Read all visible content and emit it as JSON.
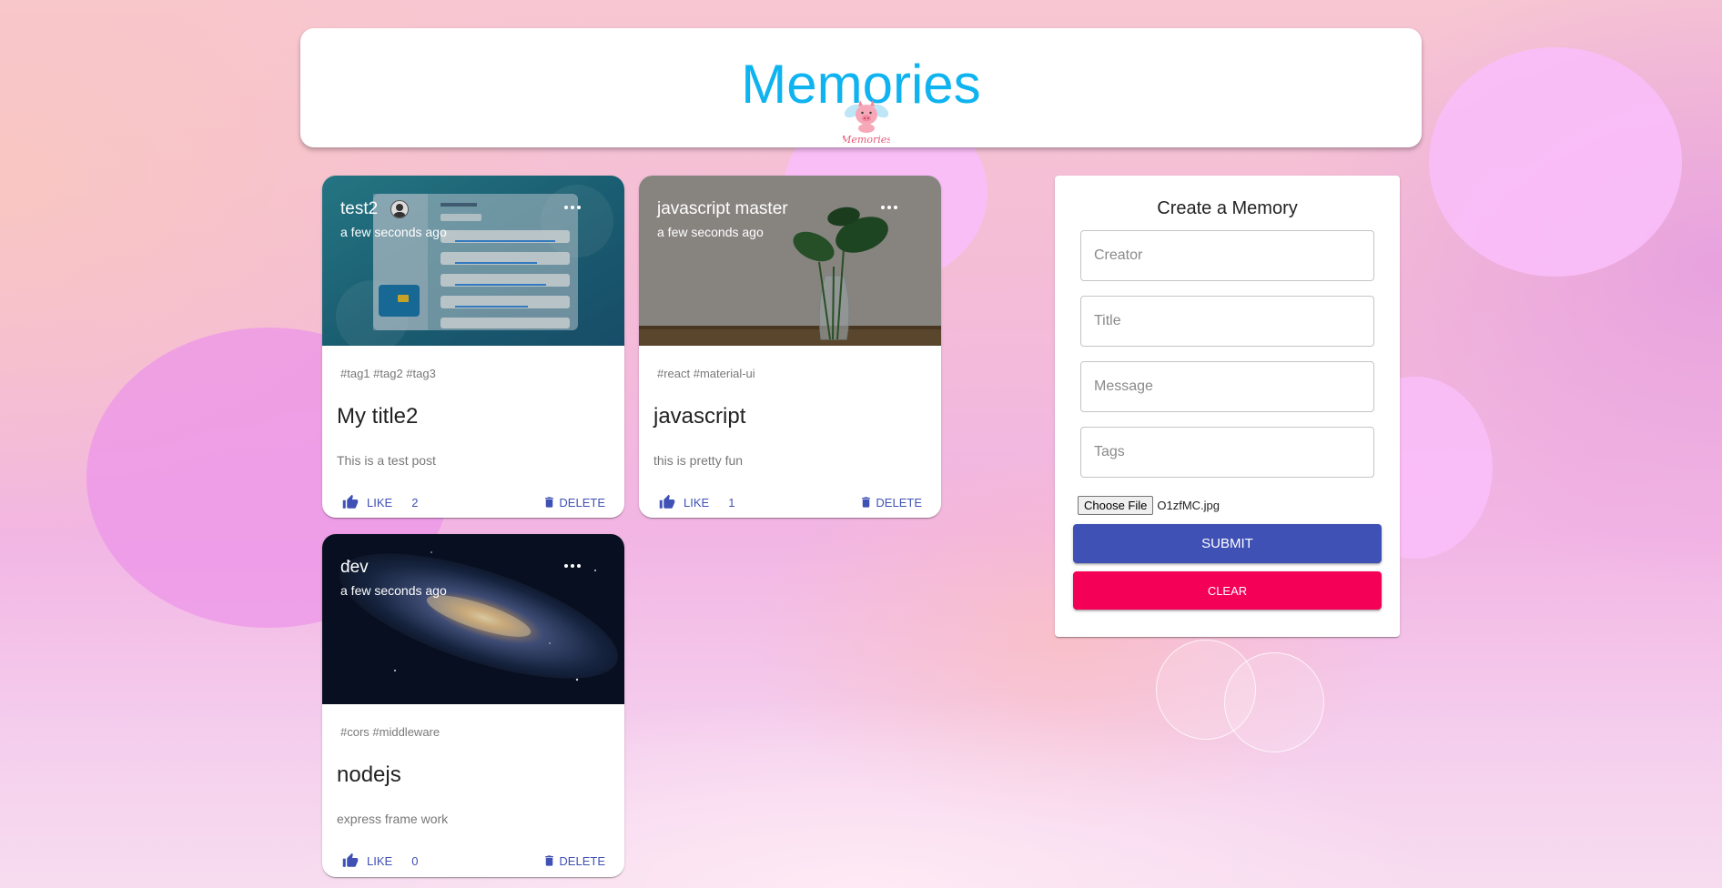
{
  "header": {
    "title": "Memories",
    "logo_icon": "flying-pig-logo-icon",
    "logo_text": "Memories"
  },
  "colors": {
    "title": "#0fb3f0",
    "primary": "#3f51b5",
    "secondary": "#f50057"
  },
  "posts": [
    {
      "creator": "test2",
      "time": "a few seconds ago",
      "tags": "#tag1 #tag2 #tag3",
      "title": "My title2",
      "message": "This is a test post",
      "like_label": "LIKE",
      "like_count": "2",
      "delete_label": "DELETE",
      "image": "dashboard-screenshot"
    },
    {
      "creator": "javascript master",
      "time": "a few seconds ago",
      "tags": "#react #material-ui",
      "title": "javascript",
      "message": "this is pretty fun",
      "like_label": "LIKE",
      "like_count": "1",
      "delete_label": "DELETE",
      "image": "plant-in-vase"
    },
    {
      "creator": "dev",
      "time": "a few seconds ago",
      "tags": "#cors #middleware",
      "title": "nodejs",
      "message": "express frame work",
      "like_label": "LIKE",
      "like_count": "0",
      "delete_label": "DELETE",
      "image": "galaxy"
    }
  ],
  "form": {
    "title": "Create a Memory",
    "creator_placeholder": "Creator",
    "title_placeholder": "Title",
    "message_placeholder": "Message",
    "tags_placeholder": "Tags",
    "file_button": "Choose File",
    "file_name": "O1zfMC.jpg",
    "submit_label": "SUBMIT",
    "clear_label": "CLEAR"
  }
}
